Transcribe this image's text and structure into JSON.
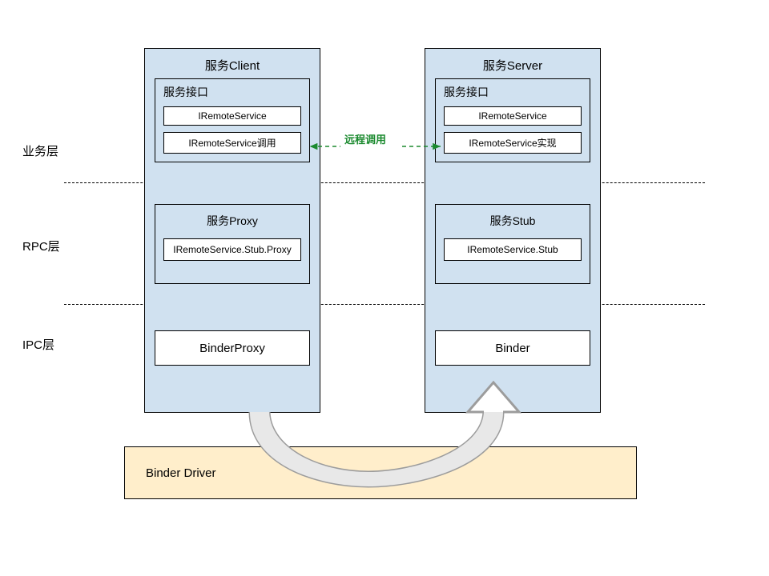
{
  "layers": {
    "business": "业务层",
    "rpc": "RPC层",
    "ipc": "IPC层"
  },
  "client": {
    "title": "服务Client",
    "interface": {
      "title": "服务接口",
      "remote_service": "IRemoteService",
      "remote_service_call": "IRemoteService调用"
    },
    "proxy": {
      "title": "服务Proxy",
      "class": "IRemoteService.Stub.Proxy"
    },
    "ipc": {
      "class": "BinderProxy"
    }
  },
  "server": {
    "title": "服务Server",
    "interface": {
      "title": "服务接口",
      "remote_service": "IRemoteService",
      "remote_service_impl": "IRemoteService实现"
    },
    "stub": {
      "title": "服务Stub",
      "class": "IRemoteService.Stub"
    },
    "ipc": {
      "class": "Binder"
    }
  },
  "remote_call": "远程调用",
  "driver": "Binder Driver"
}
